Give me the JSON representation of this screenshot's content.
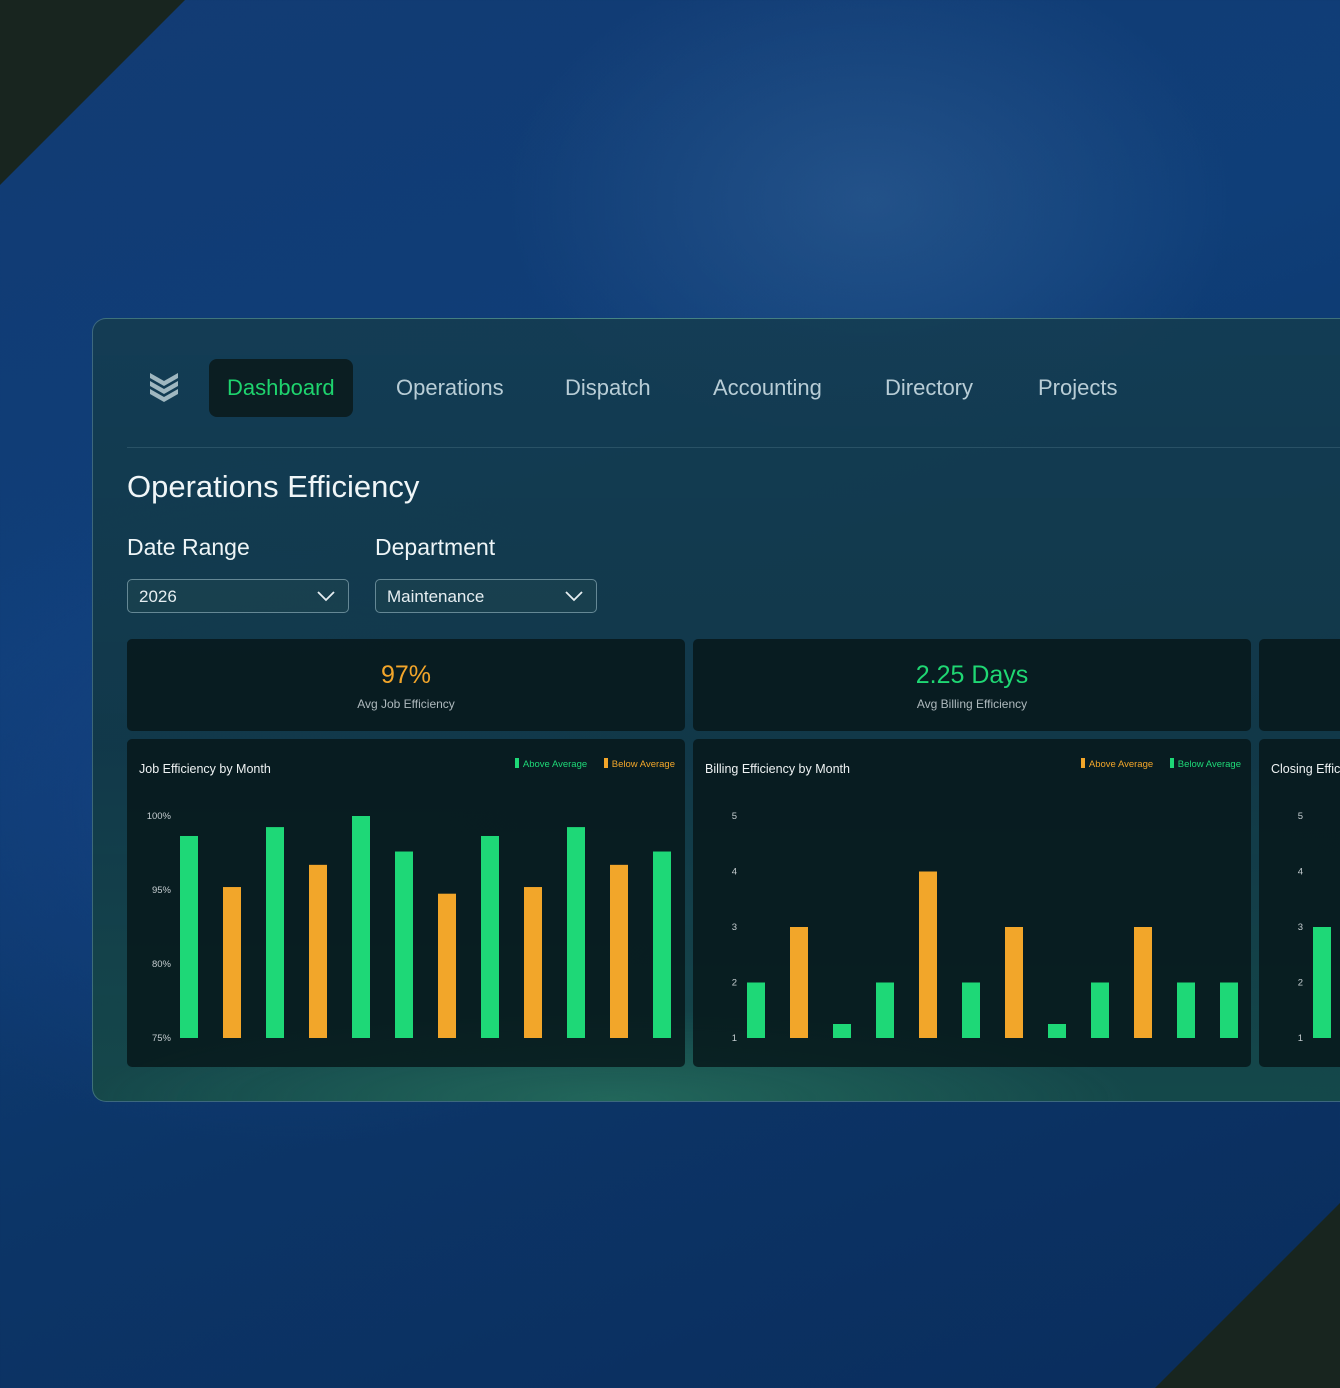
{
  "nav": {
    "tabs": [
      {
        "label": "Dashboard",
        "active": true
      },
      {
        "label": "Operations"
      },
      {
        "label": "Dispatch"
      },
      {
        "label": "Accounting"
      },
      {
        "label": "Directory"
      },
      {
        "label": "Projects"
      }
    ]
  },
  "page": {
    "title": "Operations Efficiency"
  },
  "filters": {
    "date_range": {
      "label": "Date Range",
      "value": "2026"
    },
    "department": {
      "label": "Department",
      "value": "Maintenance"
    }
  },
  "kpis": [
    {
      "value": "97%",
      "label": "Avg Job Efficiency",
      "color": "#f2a52a"
    },
    {
      "value": "2.25 Days",
      "label": "Avg Billing Efficiency",
      "color": "#1fd773"
    }
  ],
  "colors": {
    "green": "#1ed877",
    "orange": "#f2a62a",
    "active_tab": "#1ed46e"
  },
  "chart_data": [
    {
      "type": "bar",
      "title": "Job Efficiency by Month",
      "legend": [
        {
          "label": "Above Average",
          "color": "#1ed877"
        },
        {
          "label": "Below Average",
          "color": "#f2a62a"
        }
      ],
      "y_ticks": [
        "100%",
        "95%",
        "80%",
        "75%"
      ],
      "values": [
        0.91,
        0.68,
        0.95,
        0.78,
        1.0,
        0.84,
        0.65,
        0.91,
        0.68,
        0.95,
        0.78,
        0.84
      ],
      "series_flags": [
        "above",
        "below",
        "above",
        "below",
        "above",
        "above",
        "below",
        "above",
        "below",
        "above",
        "below",
        "above"
      ]
    },
    {
      "type": "bar",
      "title": "Billing Efficiency by Month",
      "legend": [
        {
          "label": "Above Average",
          "color": "#f2a62a"
        },
        {
          "label": "Below Average",
          "color": "#1ed877"
        }
      ],
      "y_ticks": [
        "5",
        "4",
        "3",
        "2",
        "1"
      ],
      "ylim": [
        1,
        5
      ],
      "values": [
        2,
        3,
        1.25,
        2,
        4,
        2,
        3,
        1.25,
        2,
        3,
        2,
        2
      ],
      "series_flags": [
        "below",
        "above",
        "below",
        "below",
        "above",
        "below",
        "above",
        "below",
        "below",
        "above",
        "below",
        "below"
      ]
    },
    {
      "type": "bar",
      "title": "Closing Effic",
      "y_ticks": [
        "5",
        "4",
        "3",
        "2",
        "1"
      ],
      "ylim": [
        1,
        5
      ],
      "values": [
        3
      ],
      "series_flags": [
        "below"
      ]
    }
  ]
}
